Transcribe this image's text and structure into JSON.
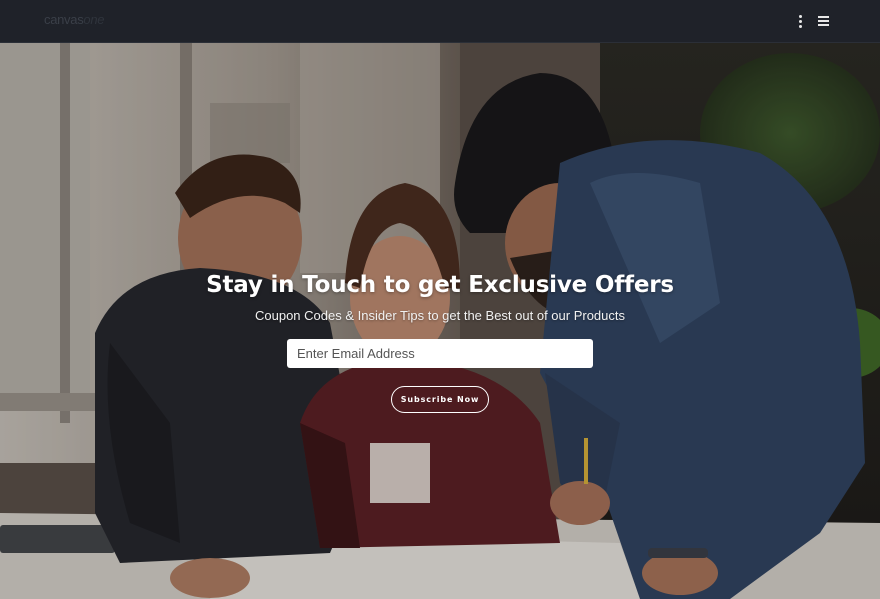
{
  "header": {
    "logo_main": "canvas",
    "logo_suffix": "one",
    "menu_icon": "kebab-menu-icon",
    "nav_icon": "hamburger-icon"
  },
  "hero": {
    "title": "Stay in Touch to get Exclusive Offers",
    "subtitle": "Coupon Codes & Insider Tips to get the Best out of our Products",
    "email_placeholder": "Enter Email Address",
    "email_value": "",
    "button_label": "Subscribe Now"
  },
  "colors": {
    "topbar": "#1f2229",
    "text": "#ffffff"
  }
}
